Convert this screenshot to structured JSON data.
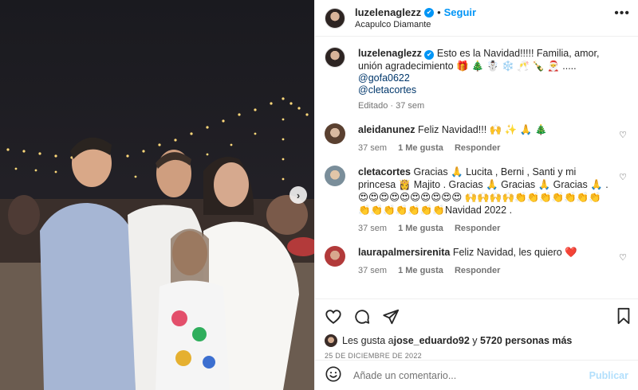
{
  "header": {
    "username": "luzelenaglezz",
    "follow_label": "Seguir",
    "location": "Acapulco Diamante",
    "more_label": "•••"
  },
  "caption": {
    "username": "luzelenaglezz",
    "text": "Esto es la Navidad!!!!! Familia, amor, unión agradecimiento 🎁 🎄 ☃️ ❄️ 🥂 🍾 🎅 .....",
    "mentions": [
      "@gofa0622",
      "@cletacortes"
    ],
    "edited": "Editado · 37 sem"
  },
  "comments": [
    {
      "username": "aleidanunez",
      "text": "Feliz Navidad!!! 🙌 ✨ 🙏 🎄",
      "time": "37 sem",
      "likes": "1 Me gusta",
      "reply": "Responder"
    },
    {
      "username": "cletacortes",
      "text": "Gracias 🙏 Lucita , Berni , Santi y mi princesa 👸 Majito . Gracias 🙏 Gracias 🙏 Gracias 🙏 . 😍😍😍😍😍😍😍😍😍😍 🙌🙌🙌🙌👏👏👏👏👏👏👏👏👏👏👏👏👏👏Navidad 2022 .",
      "time": "37 sem",
      "likes": "1 Me gusta",
      "reply": "Responder"
    },
    {
      "username": "laurapalmersirenita",
      "text": "Feliz Navidad, les quiero ❤️",
      "time": "37 sem",
      "likes": "1 Me gusta",
      "reply": "Responder"
    }
  ],
  "likes": {
    "prefix": "Les gusta a ",
    "user": "jose_eduardo92",
    "middle": " y ",
    "count": "5720 personas más"
  },
  "date": "25 DE DICIEMBRE DE 2022",
  "add_comment": {
    "placeholder": "Añade un comentario...",
    "post_label": "Publicar"
  },
  "icons": {
    "like": "heart-icon",
    "comment": "comment-icon",
    "share": "share-icon",
    "save": "bookmark-icon",
    "emoji": "emoji-icon",
    "next": "chevron-right-icon"
  },
  "colors": {
    "accent": "#0095f6",
    "mention": "#00376b",
    "muted": "#737373",
    "post_disabled": "#b2dffc"
  }
}
